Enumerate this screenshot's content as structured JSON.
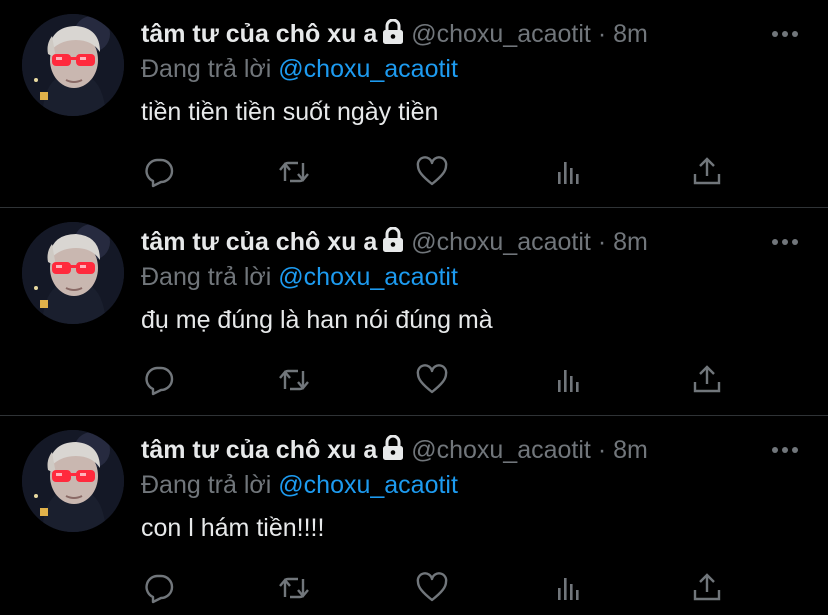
{
  "colors": {
    "background": "#000000",
    "text_primary": "#e7e9ea",
    "text_secondary": "#71767b",
    "accent": "#1d9bf0",
    "divider": "#2f3336"
  },
  "tweets": [
    {
      "display_name": "tâm tư của chô xu a",
      "handle": "@choxu_acaotit",
      "separator": "·",
      "time": "8m",
      "reply_prefix": "Đang trả lời ",
      "reply_mention": "@choxu_acaotit",
      "text": "tiền tiền tiền suốt ngày tiền",
      "icons": [
        "lock-icon",
        "more-icon",
        "reply-icon",
        "retweet-icon",
        "like-icon",
        "views-icon",
        "share-icon"
      ]
    },
    {
      "display_name": "tâm tư của chô xu a",
      "handle": "@choxu_acaotit",
      "separator": "·",
      "time": "8m",
      "reply_prefix": "Đang trả lời ",
      "reply_mention": "@choxu_acaotit",
      "text": "đụ mẹ đúng là han nói đúng mà",
      "icons": [
        "lock-icon",
        "more-icon",
        "reply-icon",
        "retweet-icon",
        "like-icon",
        "views-icon",
        "share-icon"
      ]
    },
    {
      "display_name": "tâm tư của chô xu a",
      "handle": "@choxu_acaotit",
      "separator": "·",
      "time": "8m",
      "reply_prefix": "Đang trả lời ",
      "reply_mention": "@choxu_acaotit",
      "text": "con l hám tiền!!!!",
      "icons": [
        "lock-icon",
        "more-icon",
        "reply-icon",
        "retweet-icon",
        "like-icon",
        "views-icon",
        "share-icon"
      ]
    }
  ]
}
